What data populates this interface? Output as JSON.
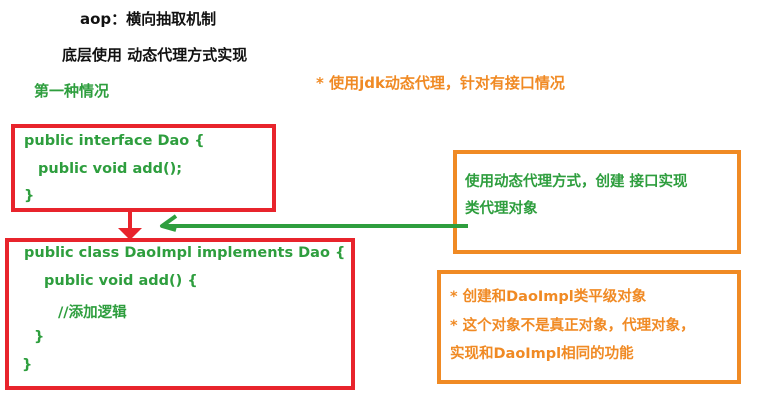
{
  "header": {
    "title": "aop：横向抽取机制",
    "subtitle": "底层使用 动态代理方式实现"
  },
  "case_label": "第一种情况",
  "jdk_note": "* 使用jdk动态代理，针对有接口情况",
  "interface_box": {
    "lines": [
      "public interface Dao {",
      "public void add();",
      "}"
    ]
  },
  "impl_box": {
    "lines": [
      "public class DaoImpl implements Dao {",
      "public void add() {",
      "//添加逻辑",
      "}",
      "}"
    ]
  },
  "proxy_box": {
    "lines": [
      "使用动态代理方式，创建 接口实现",
      "类代理对象"
    ]
  },
  "sibling_box": {
    "lines": [
      "* 创建和DaoImpl类平级对象",
      "* 这个对象不是真正对象，代理对象，",
      "实现和DaoImpl相同的功能"
    ]
  },
  "colors": {
    "red": "#e8242c",
    "green": "#2e9e3e",
    "orange": "#f08a24"
  }
}
